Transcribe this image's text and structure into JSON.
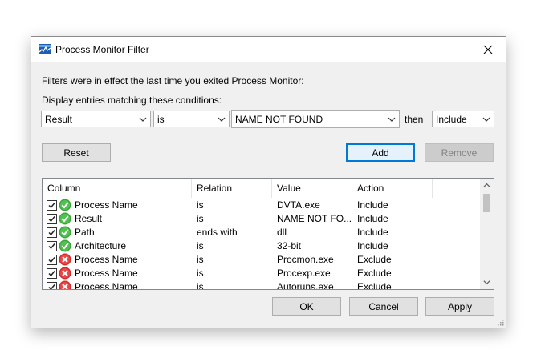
{
  "window": {
    "title": "Process Monitor Filter"
  },
  "intro_text": "Filters were in effect the last time you exited Process Monitor:",
  "conditions_label": "Display entries matching these conditions:",
  "filter": {
    "column": "Result",
    "relation": "is",
    "value": "NAME NOT FOUND",
    "then_label": "then",
    "action": "Include"
  },
  "buttons": {
    "reset": "Reset",
    "add": "Add",
    "remove": "Remove",
    "ok": "OK",
    "cancel": "Cancel",
    "apply": "Apply"
  },
  "table": {
    "headers": [
      "Column",
      "Relation",
      "Value",
      "Action"
    ],
    "rows": [
      {
        "checked": true,
        "status_icon": "check-icon",
        "column": "Process Name",
        "relation": "is",
        "value": "DVTA.exe",
        "action": "Include"
      },
      {
        "checked": true,
        "status_icon": "check-icon",
        "column": "Result",
        "relation": "is",
        "value": "NAME NOT FO...",
        "action": "Include"
      },
      {
        "checked": true,
        "status_icon": "check-icon",
        "column": "Path",
        "relation": "ends with",
        "value": "dll",
        "action": "Include"
      },
      {
        "checked": true,
        "status_icon": "check-icon",
        "column": "Architecture",
        "relation": "is",
        "value": "32-bit",
        "action": "Include"
      },
      {
        "checked": true,
        "status_icon": "exclude-icon",
        "column": "Process Name",
        "relation": "is",
        "value": "Procmon.exe",
        "action": "Exclude"
      },
      {
        "checked": true,
        "status_icon": "exclude-icon",
        "column": "Process Name",
        "relation": "is",
        "value": "Procexp.exe",
        "action": "Exclude"
      },
      {
        "checked": true,
        "status_icon": "exclude-icon",
        "column": "Process Name",
        "relation": "is",
        "value": "Autoruns.exe",
        "action": "Exclude"
      }
    ]
  },
  "colors": {
    "accent": "#0078d7",
    "include": "#3aa53a",
    "exclude": "#d42a2a"
  }
}
